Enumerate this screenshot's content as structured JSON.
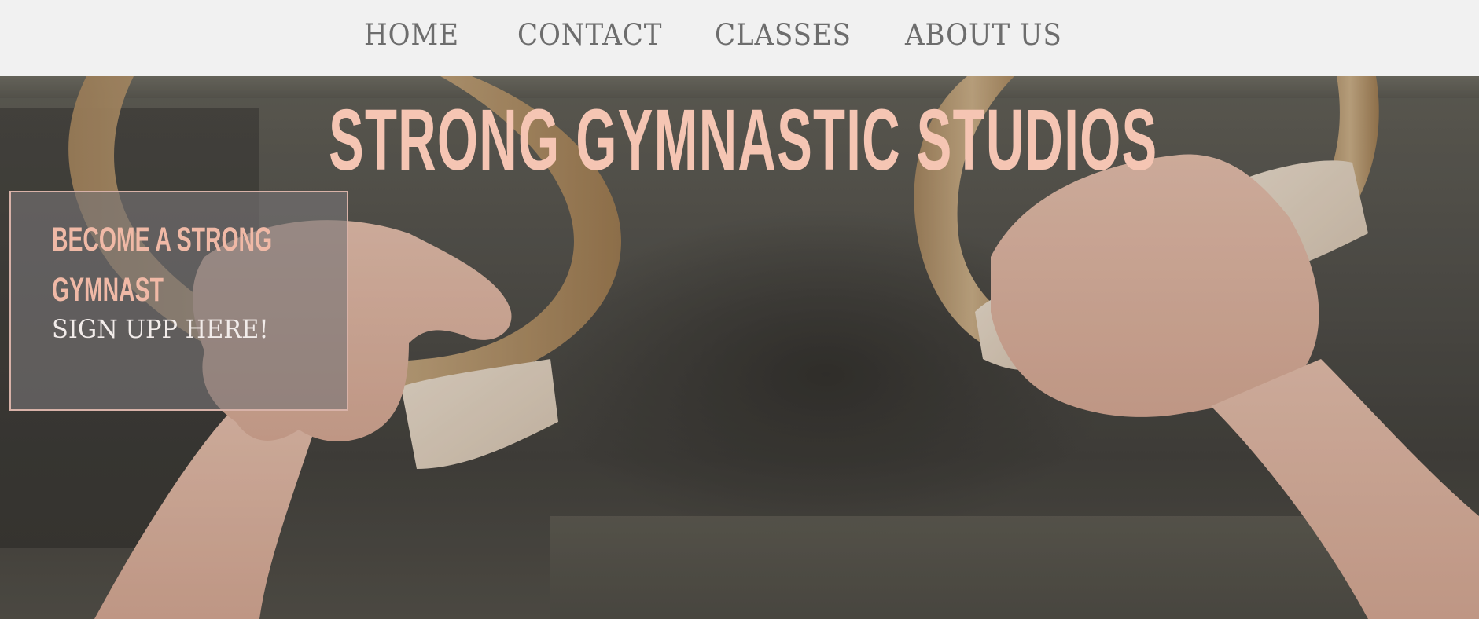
{
  "nav": {
    "items": [
      {
        "label": "HOME"
      },
      {
        "label": "CONTACT"
      },
      {
        "label": "CLASSES"
      },
      {
        "label": "ABOUT US"
      }
    ]
  },
  "hero": {
    "title": "STRONG GYMNASTIC STUDIOS",
    "image_alt_semantic": "hands-on-gymnastic-rings"
  },
  "signup": {
    "heading_line1": "BECOME A STRONG",
    "heading_line2": "GYMNAST",
    "link": "SIGN UPP HERE!"
  },
  "colors": {
    "nav_bg": "#f1f1f1",
    "nav_text": "#6d6d6d",
    "accent_peach": "#f5c5b3",
    "box_border": "#d8b2a8",
    "link_text": "#f2ecea"
  }
}
